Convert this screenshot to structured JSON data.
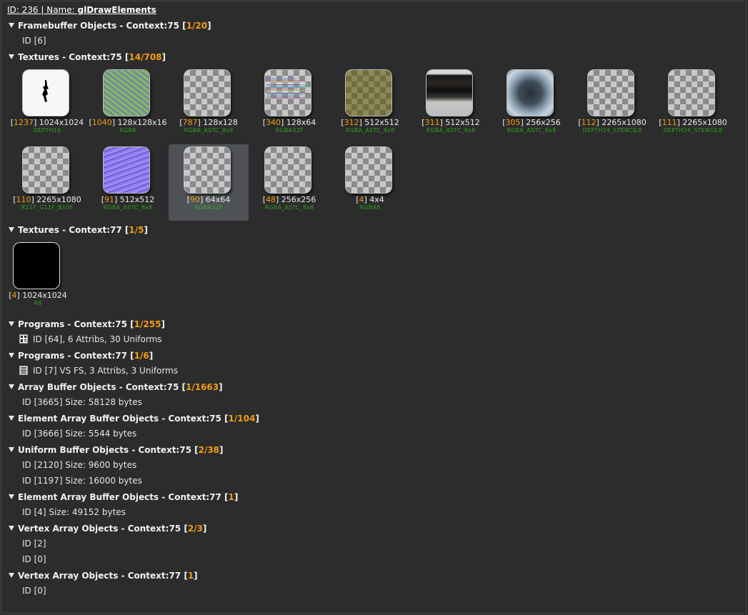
{
  "header": {
    "id_text": "ID: 236 | Name: ",
    "name": "glDrawElements"
  },
  "sections": {
    "fbo75": {
      "title": "Framebuffer Objects - Context:75 ",
      "count": "1/20",
      "rows": [
        "ID [6]"
      ]
    },
    "tex75": {
      "title": "Textures - Context:75 ",
      "count": "14/708",
      "items": [
        {
          "id": "1237",
          "size": "1024x1024",
          "format": "DEPTH16"
        },
        {
          "id": "1040",
          "size": "128x128x16",
          "format": "RGB8"
        },
        {
          "id": "787",
          "size": "128x128",
          "format": "RGBA_ASTC_8x8"
        },
        {
          "id": "340",
          "size": "128x64",
          "format": "RGBA32F"
        },
        {
          "id": "312",
          "size": "512x512",
          "format": "RGBA_ASTC_8x8"
        },
        {
          "id": "311",
          "size": "512x512",
          "format": "RGBA_ASTC_8x8"
        },
        {
          "id": "305",
          "size": "256x256",
          "format": "RGBA_ASTC_8x8"
        },
        {
          "id": "112",
          "size": "2265x1080",
          "format": "DEPTH24_STENCIL8"
        },
        {
          "id": "111",
          "size": "2265x1080",
          "format": "DEPTH24_STENCIL8"
        },
        {
          "id": "110",
          "size": "2265x1080",
          "format": "R11F_G11F_B10F"
        },
        {
          "id": "91",
          "size": "512x512",
          "format": "RGBA_ASTC_8x8"
        },
        {
          "id": "90",
          "size": "64x64",
          "format": "RGBA32F"
        },
        {
          "id": "48",
          "size": "256x256",
          "format": "RGBA_ASTC_8x8"
        },
        {
          "id": "4",
          "size": "4x4",
          "format": "RGBA8"
        }
      ]
    },
    "tex77": {
      "title": "Textures - Context:77 ",
      "count": "1/5",
      "items": [
        {
          "id": "4",
          "size": "1024x1024",
          "format": "R8"
        }
      ]
    },
    "prog75": {
      "title": "Programs - Context:75 ",
      "count": "1/255",
      "rows": [
        "ID [64], 6 Attribs, 30 Uniforms"
      ]
    },
    "prog77": {
      "title": "Programs - Context:77 ",
      "count": "1/6",
      "rows": [
        "ID [7] VS FS, 3 Attribs, 3 Uniforms"
      ]
    },
    "abo75": {
      "title": "Array Buffer Objects - Context:75 ",
      "count": "1/1663",
      "rows": [
        "ID [3665] Size: 58128 bytes"
      ]
    },
    "eabo75": {
      "title": "Element Array Buffer Objects - Context:75 ",
      "count": "1/104",
      "rows": [
        "ID [3666] Size: 5544 bytes"
      ]
    },
    "ubo75": {
      "title": "Uniform Buffer Objects - Context:75 ",
      "count": "2/38",
      "rows": [
        "ID [2120] Size: 9600 bytes",
        "ID [1197] Size: 16000 bytes"
      ]
    },
    "eabo77": {
      "title": "Element Array Buffer Objects - Context:77 ",
      "count": "1",
      "rows": [
        "ID [4] Size: 49152 bytes"
      ]
    },
    "vao75": {
      "title": "Vertex Array Objects - Context:75 ",
      "count": "2/3",
      "rows": [
        "ID [2]",
        "ID [0]"
      ]
    },
    "vao77": {
      "title": "Vertex Array Objects - Context:77 ",
      "count": "1",
      "rows": [
        "ID [0]"
      ]
    }
  },
  "colors": {
    "background": "#2c2c2c",
    "count_accent": "#f39c12",
    "format_text": "#2fa01e",
    "selected_tile_bg": "#4e5256"
  },
  "icons": {
    "collapse": "triangle-down-icon",
    "program": "program-icon"
  },
  "selected_texture_id": "90"
}
